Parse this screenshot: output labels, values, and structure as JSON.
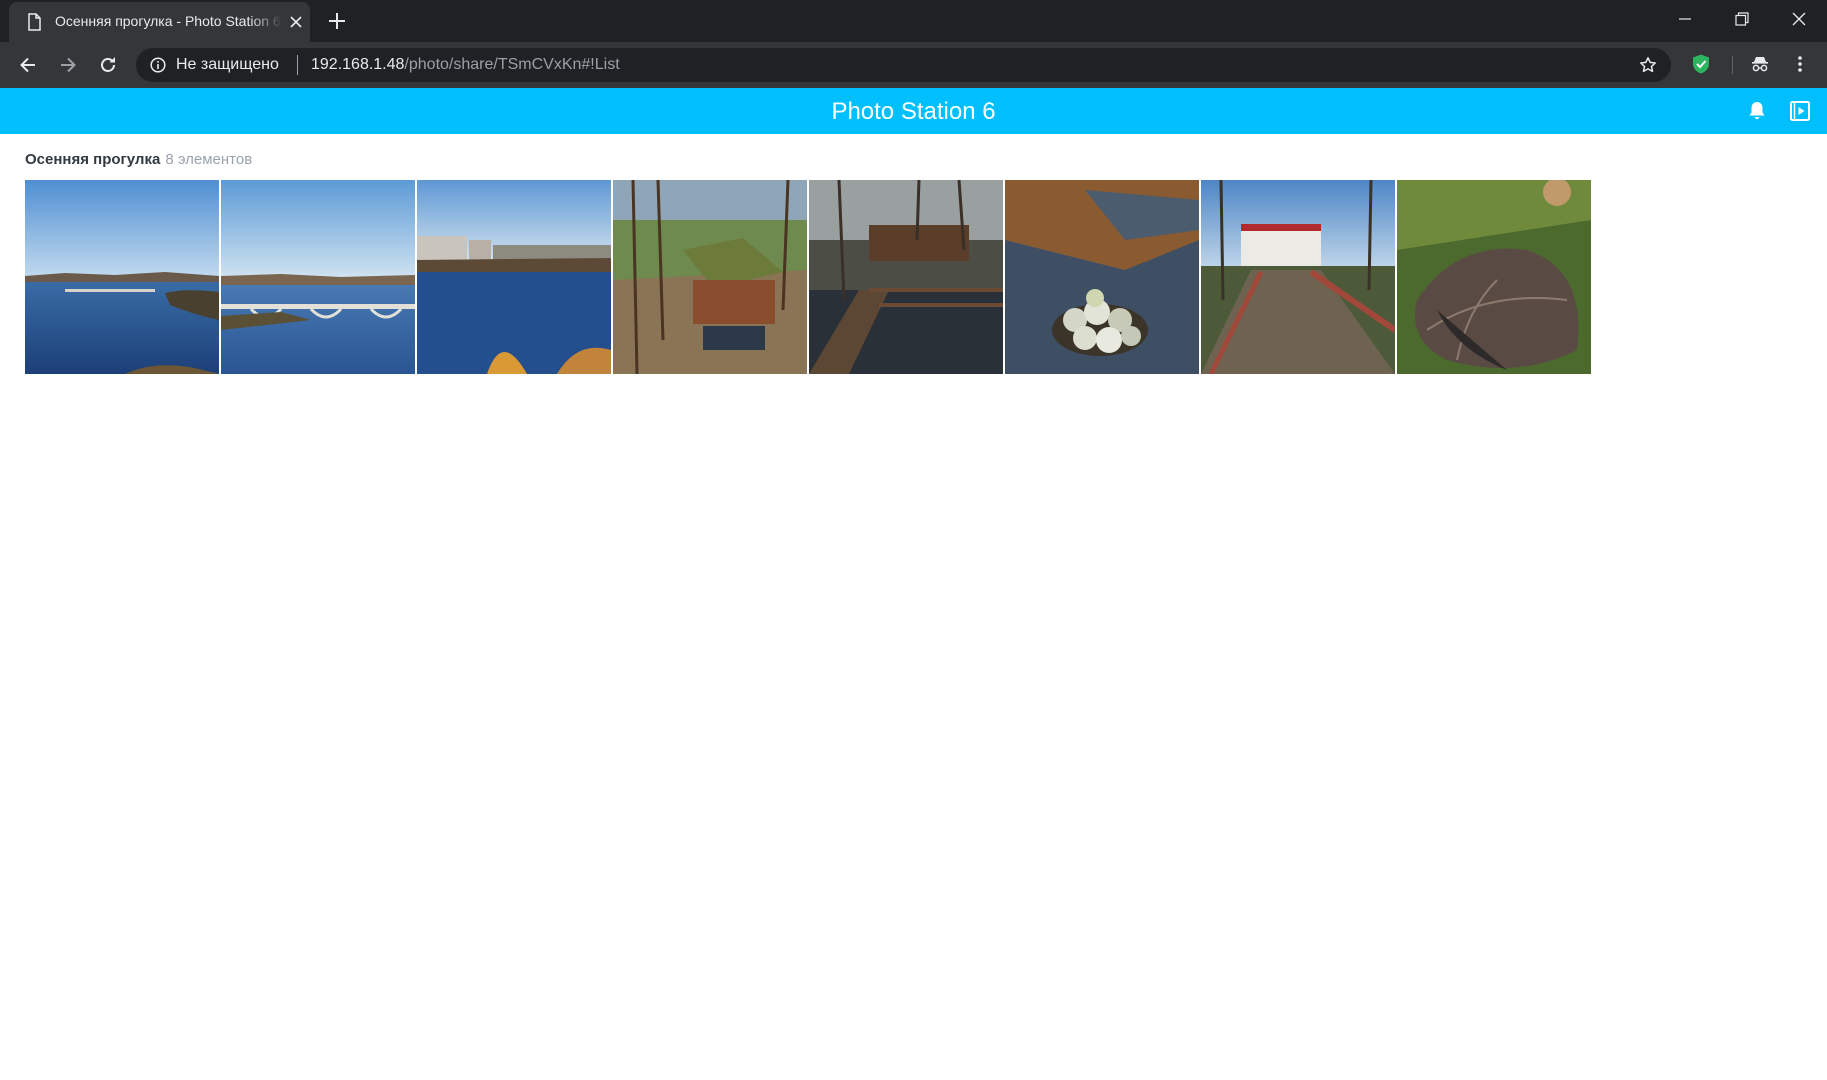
{
  "browser": {
    "tab": {
      "title": "Осенняя прогулка - Photo Station 6",
      "icon": "document-icon"
    },
    "address": {
      "security_label": "Не защищено",
      "url_host": "192.168.1.48",
      "url_path": "/photo/share/TSmCVxKn#!List"
    },
    "colors": {
      "frame": "#202124",
      "toolbar": "#35363a",
      "text": "#e8eaed",
      "muted": "#9aa0a6",
      "extension_shield": "#2eb35f"
    }
  },
  "app": {
    "title": "Photo Station 6",
    "header_color": "#00bfff",
    "header_icons": [
      "bell-icon",
      "slideshow-icon"
    ]
  },
  "album": {
    "name": "Осенняя прогулка",
    "count_label": "8 элементов",
    "photos": [
      {
        "subject": "river-bridge-panorama"
      },
      {
        "subject": "river-bridge-closeup"
      },
      {
        "subject": "river-city-view"
      },
      {
        "subject": "wooden-gazebo-pond"
      },
      {
        "subject": "wooden-pier-trees"
      },
      {
        "subject": "stones-on-ice"
      },
      {
        "subject": "wooden-bridge-house"
      },
      {
        "subject": "fallen-leaf-moss"
      }
    ]
  }
}
